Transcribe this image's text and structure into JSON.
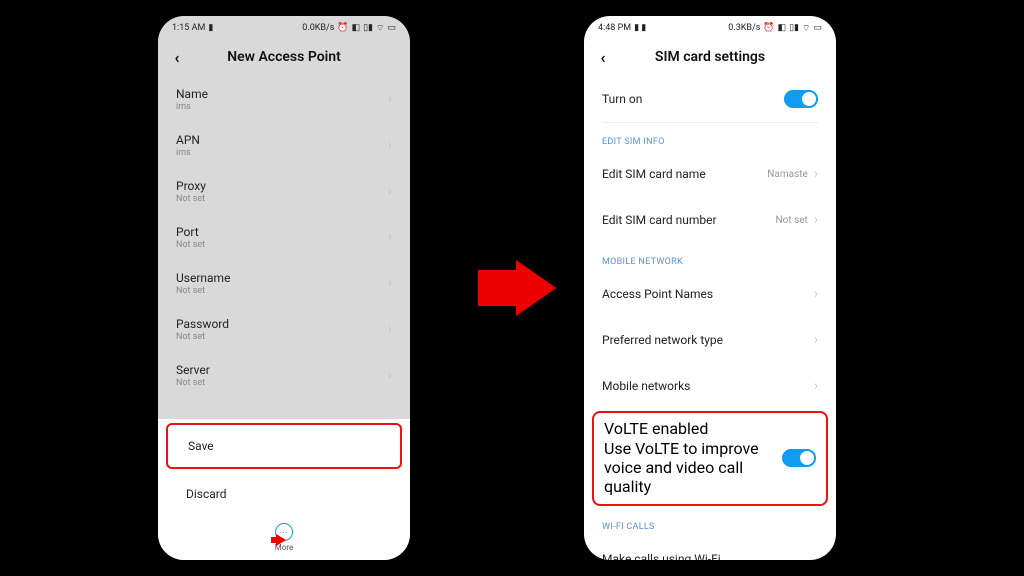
{
  "left": {
    "status": {
      "time": "1:15 AM",
      "rec": "⬛",
      "rate": "0.0KB/s",
      "icons": "⏰ ✉ ⊜ 📶 🔋"
    },
    "title": "New Access Point",
    "items": [
      {
        "label": "Name",
        "sub": "ims"
      },
      {
        "label": "APN",
        "sub": "ims"
      },
      {
        "label": "Proxy",
        "sub": "Not set"
      },
      {
        "label": "Port",
        "sub": "Not set"
      },
      {
        "label": "Username",
        "sub": "Not set"
      },
      {
        "label": "Password",
        "sub": "Not set"
      },
      {
        "label": "Server",
        "sub": "Not set"
      }
    ],
    "sheet": {
      "save": "Save",
      "discard": "Discard",
      "more": "More"
    }
  },
  "right": {
    "status": {
      "time": "4:48 PM",
      "rec": "⬛ ⬛",
      "rate": "0.3KB/s",
      "icons": "⏰ ✉ ⊜ 📶 🔋"
    },
    "title": "SIM card settings",
    "turn_on": "Turn on",
    "sec_edit": "EDIT SIM INFO",
    "edit_name": {
      "label": "Edit SIM card name",
      "value": "Namaste"
    },
    "edit_num": {
      "label": "Edit SIM card number",
      "value": "Not set"
    },
    "sec_net": "MOBILE NETWORK",
    "apn": "Access Point Names",
    "pref": "Preferred network type",
    "mob": "Mobile networks",
    "volte": {
      "label": "VoLTE enabled",
      "sub": "Use VoLTE to improve voice and video call quality"
    },
    "sec_wifi": "WI-FI CALLS",
    "wifi_calls": "Make calls using Wi-Fi"
  }
}
